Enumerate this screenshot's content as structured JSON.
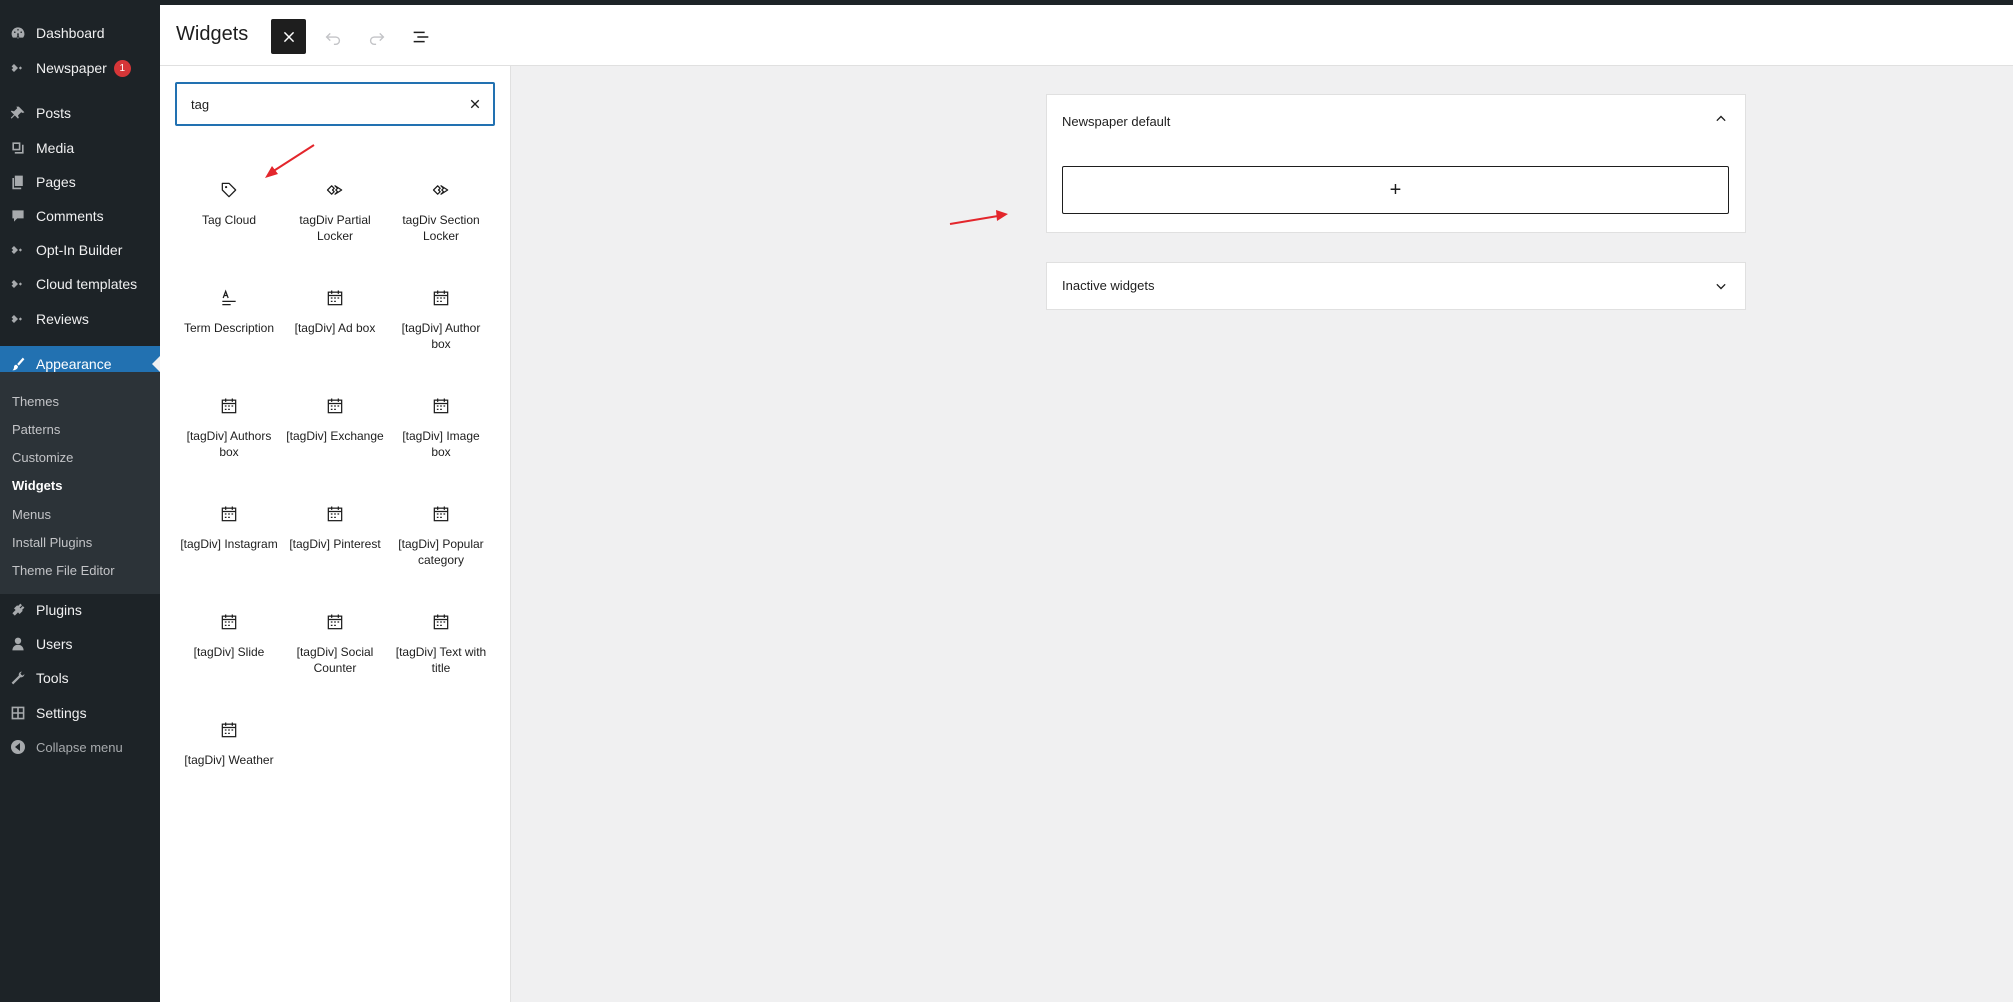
{
  "sidebar": {
    "items": [
      {
        "label": "Dashboard",
        "icon": "dashboard-icon"
      },
      {
        "label": "Newspaper",
        "icon": "newspaper-icon",
        "badge": "1"
      },
      {
        "label": "Posts",
        "icon": "pin-icon"
      },
      {
        "label": "Media",
        "icon": "media-icon"
      },
      {
        "label": "Pages",
        "icon": "pages-icon"
      },
      {
        "label": "Comments",
        "icon": "comments-icon"
      },
      {
        "label": "Opt-In Builder",
        "icon": "tagdiv-icon"
      },
      {
        "label": "Cloud templates",
        "icon": "tagdiv-icon"
      },
      {
        "label": "Reviews",
        "icon": "tagdiv-icon"
      },
      {
        "label": "Appearance",
        "icon": "paintbrush-icon"
      },
      {
        "label": "Plugins",
        "icon": "plugins-icon"
      },
      {
        "label": "Users",
        "icon": "users-icon"
      },
      {
        "label": "Tools",
        "icon": "tools-icon"
      },
      {
        "label": "Settings",
        "icon": "settings-icon"
      }
    ],
    "submenu": [
      "Themes",
      "Patterns",
      "Customize",
      "Widgets",
      "Menus",
      "Install Plugins",
      "Theme File Editor"
    ],
    "collapse_label": "Collapse menu"
  },
  "header": {
    "title": "Widgets"
  },
  "inserter": {
    "search_value": "tag",
    "blocks": [
      {
        "label": "Tag Cloud",
        "icon": "tag-icon"
      },
      {
        "label": "tagDiv Partial Locker",
        "icon": "tagdiv-locker-icon"
      },
      {
        "label": "tagDiv Section Locker",
        "icon": "tagdiv-locker-icon"
      },
      {
        "label": "Term Description",
        "icon": "term-description-icon"
      },
      {
        "label": "[tagDiv] Ad box",
        "icon": "calendar-icon"
      },
      {
        "label": "[tagDiv] Author box",
        "icon": "calendar-icon"
      },
      {
        "label": "[tagDiv] Authors box",
        "icon": "calendar-icon"
      },
      {
        "label": "[tagDiv] Exchange",
        "icon": "calendar-icon"
      },
      {
        "label": "[tagDiv] Image box",
        "icon": "calendar-icon"
      },
      {
        "label": "[tagDiv] Instagram",
        "icon": "calendar-icon"
      },
      {
        "label": "[tagDiv] Pinterest",
        "icon": "calendar-icon"
      },
      {
        "label": "[tagDiv] Popular category",
        "icon": "calendar-icon"
      },
      {
        "label": "[tagDiv] Slide",
        "icon": "calendar-icon"
      },
      {
        "label": "[tagDiv] Social Counter",
        "icon": "calendar-icon"
      },
      {
        "label": "[tagDiv] Text with title",
        "icon": "calendar-icon"
      },
      {
        "label": "[tagDiv] Weather",
        "icon": "calendar-icon"
      }
    ]
  },
  "widget_areas": {
    "default_title": "Newspaper default",
    "inactive_title": "Inactive widgets",
    "add_block_symbol": "+"
  },
  "colors": {
    "sidebar_bg": "#1d2327",
    "accent": "#2271b1",
    "badge": "#d63638",
    "annotation_arrow": "#e3262c"
  }
}
